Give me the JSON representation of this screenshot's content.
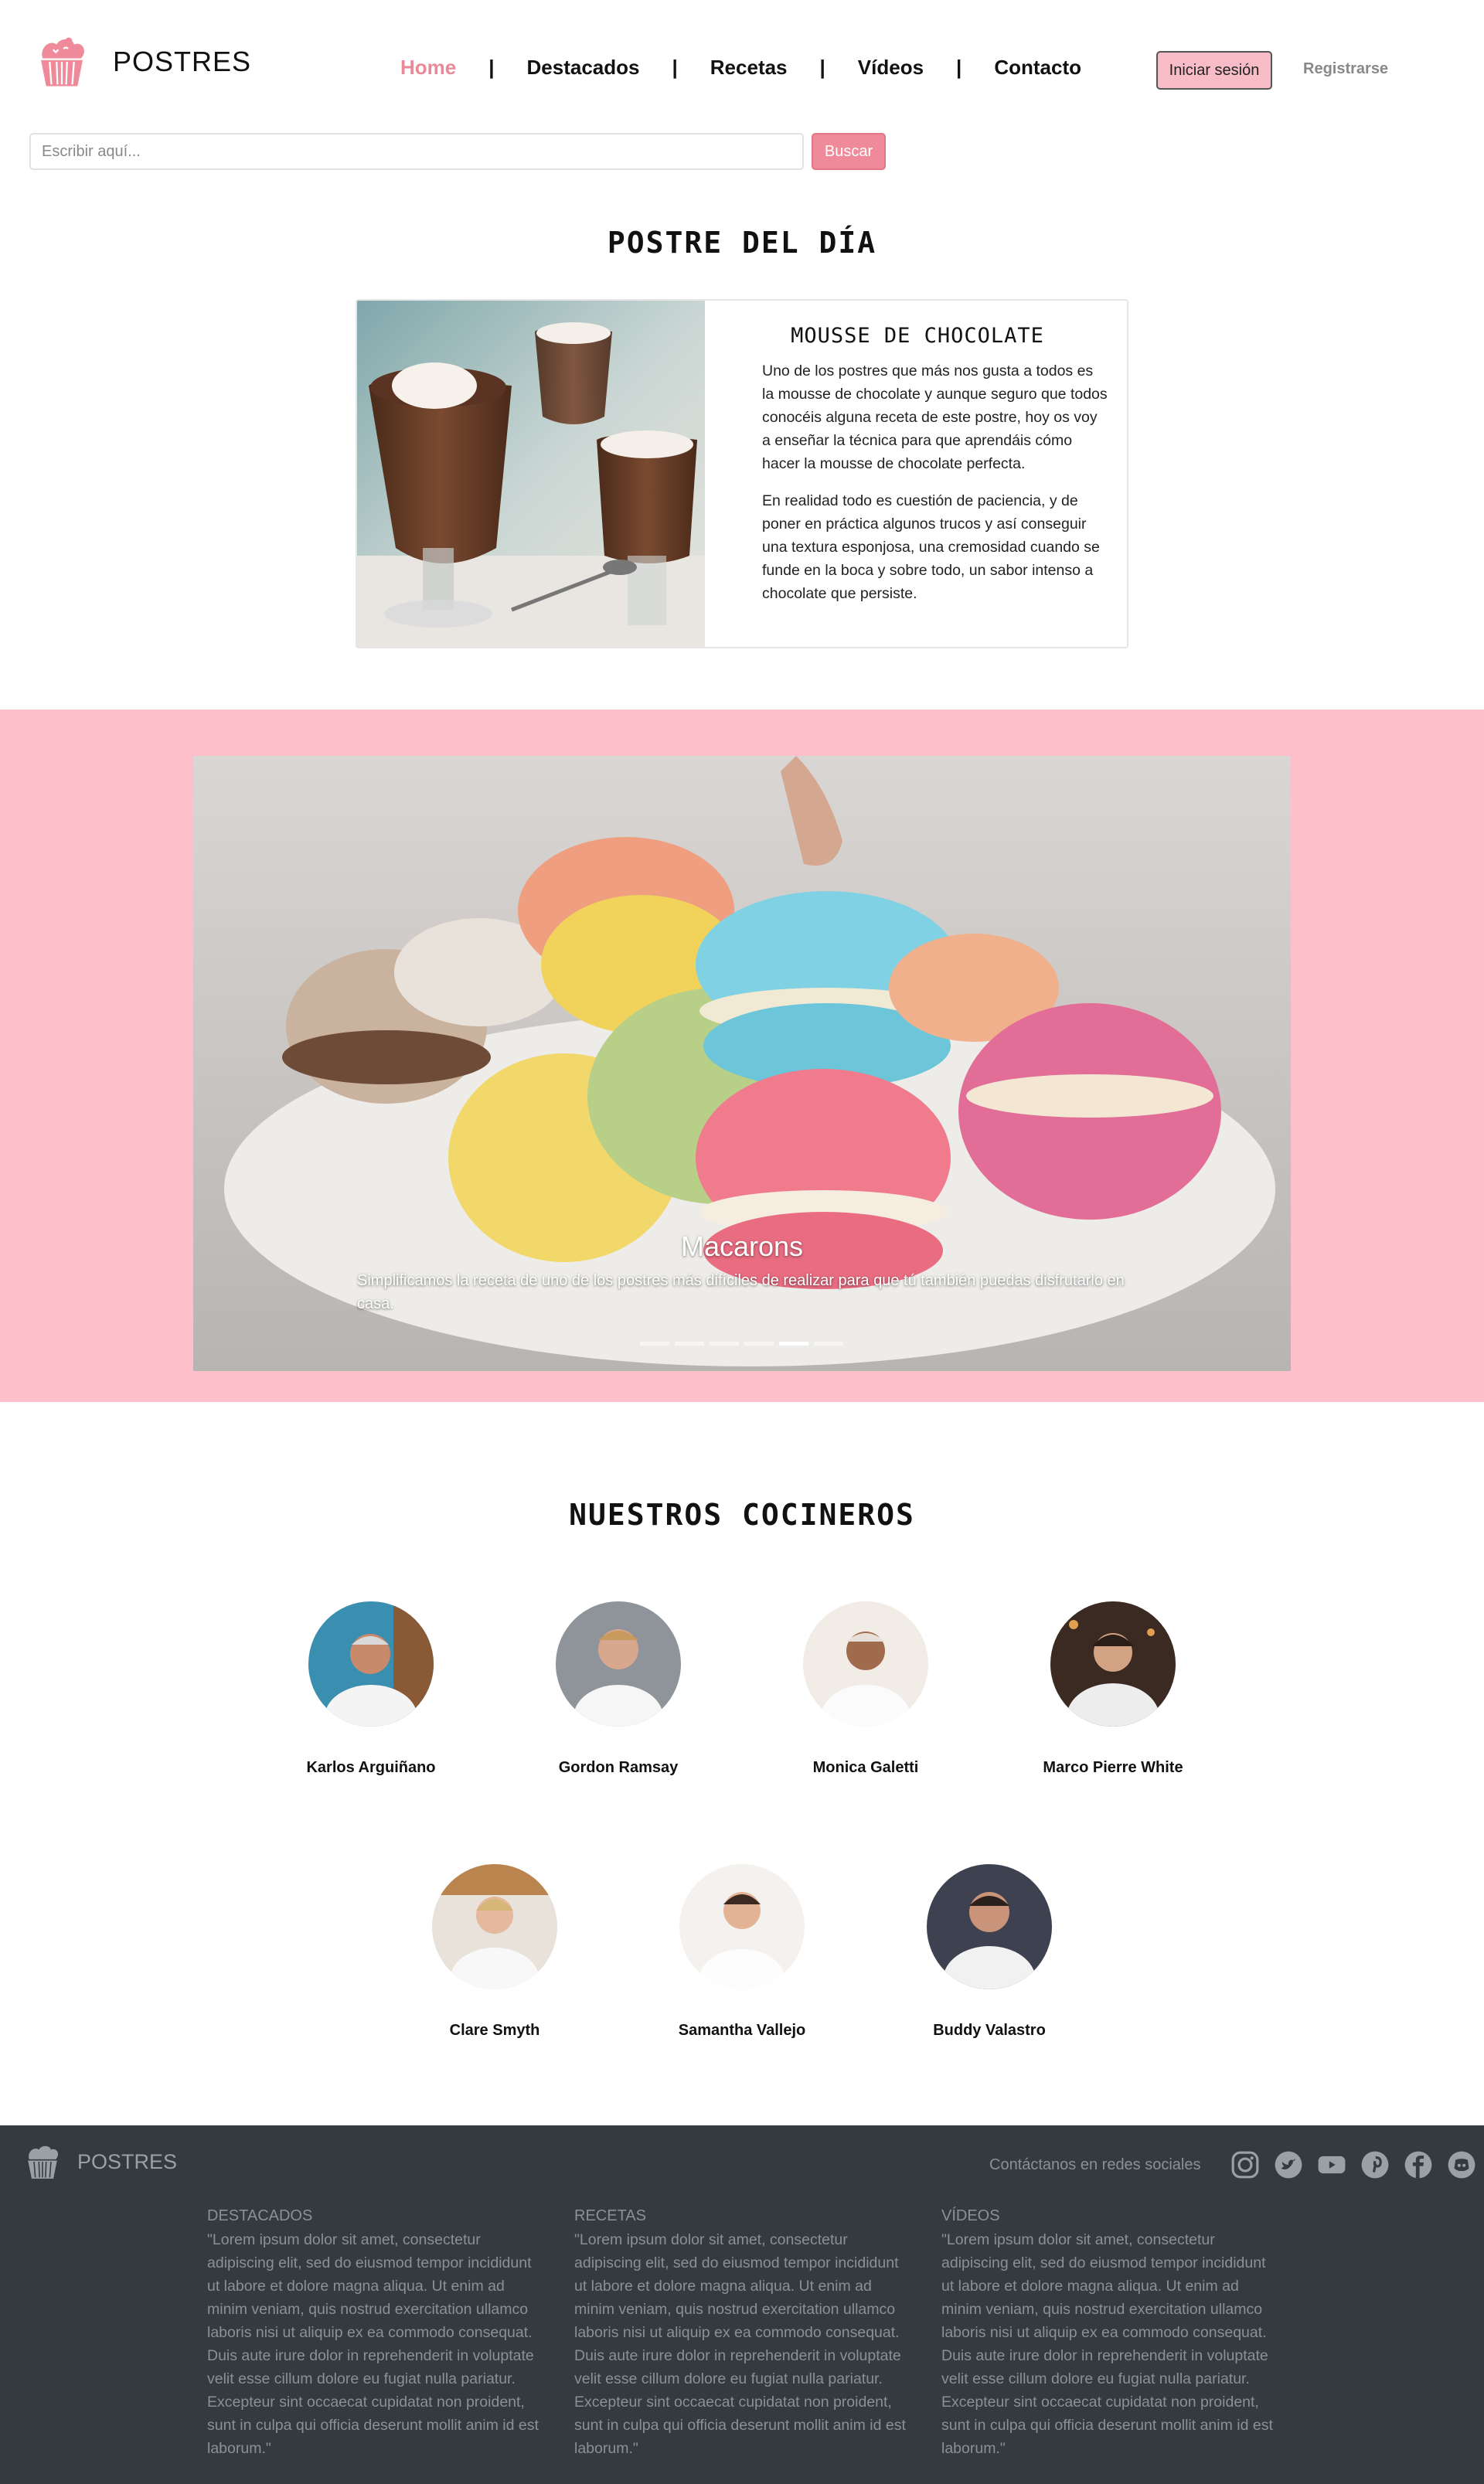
{
  "brand": {
    "name": "POSTRES",
    "logo_icon": "cupcake-icon"
  },
  "nav": {
    "items": [
      {
        "label": "Home",
        "active": true
      },
      {
        "label": "Destacados"
      },
      {
        "label": "Recetas"
      },
      {
        "label": "Vídeos"
      },
      {
        "label": "Contacto"
      }
    ],
    "separator": "|"
  },
  "auth": {
    "login_label": "Iniciar sesión",
    "register_label": "Registrarse"
  },
  "search": {
    "placeholder": "Escribir aquí...",
    "value": "",
    "button_label": "Buscar"
  },
  "dessert_of_day": {
    "section_title": "POSTRE DEL DÍA",
    "name": "MOUSSE DE CHOCOLATE",
    "paragraphs": [
      "Uno de los postres que más nos gusta a todos es la mousse de chocolate y aunque seguro que todos conocéis alguna receta de este postre, hoy os voy a enseñar la técnica para que aprendáis cómo hacer la mousse de chocolate perfecta.",
      "En realidad todo es cuestión de paciencia, y de poner en práctica algunos trucos y así conseguir una textura esponjosa, una cremosidad cuando se funde en la boca y sobre todo, un sabor intenso a chocolate que persiste."
    ]
  },
  "carousel": {
    "caption_title": "Macarons",
    "caption_text": "Simplificamos la receta de uno de los postres más difíciles de realizar para que tú también puedas disfrutarlo en casa.",
    "slide_count": 6,
    "active_index": 4
  },
  "chefs": {
    "section_title": "NUESTROS COCINEROS",
    "items": [
      {
        "name": "Karlos Arguiñano"
      },
      {
        "name": "Gordon Ramsay"
      },
      {
        "name": "Monica Galetti"
      },
      {
        "name": "Marco Pierre White"
      },
      {
        "name": "Clare Smyth"
      },
      {
        "name": "Samantha Vallejo"
      },
      {
        "name": "Buddy Valastro"
      }
    ]
  },
  "footer": {
    "brand": "POSTRES",
    "social_label": "Contáctanos en redes sociales",
    "social_icons": [
      "instagram-icon",
      "twitter-icon",
      "youtube-icon",
      "pinterest-icon",
      "facebook-icon",
      "discord-icon"
    ],
    "columns": [
      {
        "title": "DESTACADOS",
        "text": "\"Lorem ipsum dolor sit amet, consectetur adipiscing elit, sed do eiusmod tempor incididunt ut labore et dolore magna aliqua. Ut enim ad minim veniam, quis nostrud exercitation ullamco laboris nisi ut aliquip ex ea commodo consequat. Duis aute irure dolor in reprehenderit in voluptate velit esse cillum dolore eu fugiat nulla pariatur. Excepteur sint occaecat cupidatat non proident, sunt in culpa qui officia deserunt mollit anim id est laborum.\""
      },
      {
        "title": "RECETAS",
        "text": "\"Lorem ipsum dolor sit amet, consectetur adipiscing elit, sed do eiusmod tempor incididunt ut labore et dolore magna aliqua. Ut enim ad minim veniam, quis nostrud exercitation ullamco laboris nisi ut aliquip ex ea commodo consequat. Duis aute irure dolor in reprehenderit in voluptate velit esse cillum dolore eu fugiat nulla pariatur. Excepteur sint occaecat cupidatat non proident, sunt in culpa qui officia deserunt mollit anim id est laborum.\""
      },
      {
        "title": "VÍDEOS",
        "text": "\"Lorem ipsum dolor sit amet, consectetur adipiscing elit, sed do eiusmod tempor incididunt ut labore et dolore magna aliqua. Ut enim ad minim veniam, quis nostrud exercitation ullamco laboris nisi ut aliquip ex ea commodo consequat. Duis aute irure dolor in reprehenderit in voluptate velit esse cillum dolore eu fugiat nulla pariatur. Excepteur sint occaecat cupidatat non proident, sunt in culpa qui officia deserunt mollit anim id est laborum.\""
      }
    ]
  },
  "colors": {
    "accent": "#e88a98",
    "band_pink": "#fdc0cb",
    "login_button": "#f7bcc6",
    "search_button": "#ef8a9a",
    "footer_bg": "#343a40",
    "footer_text": "#8a9096"
  }
}
